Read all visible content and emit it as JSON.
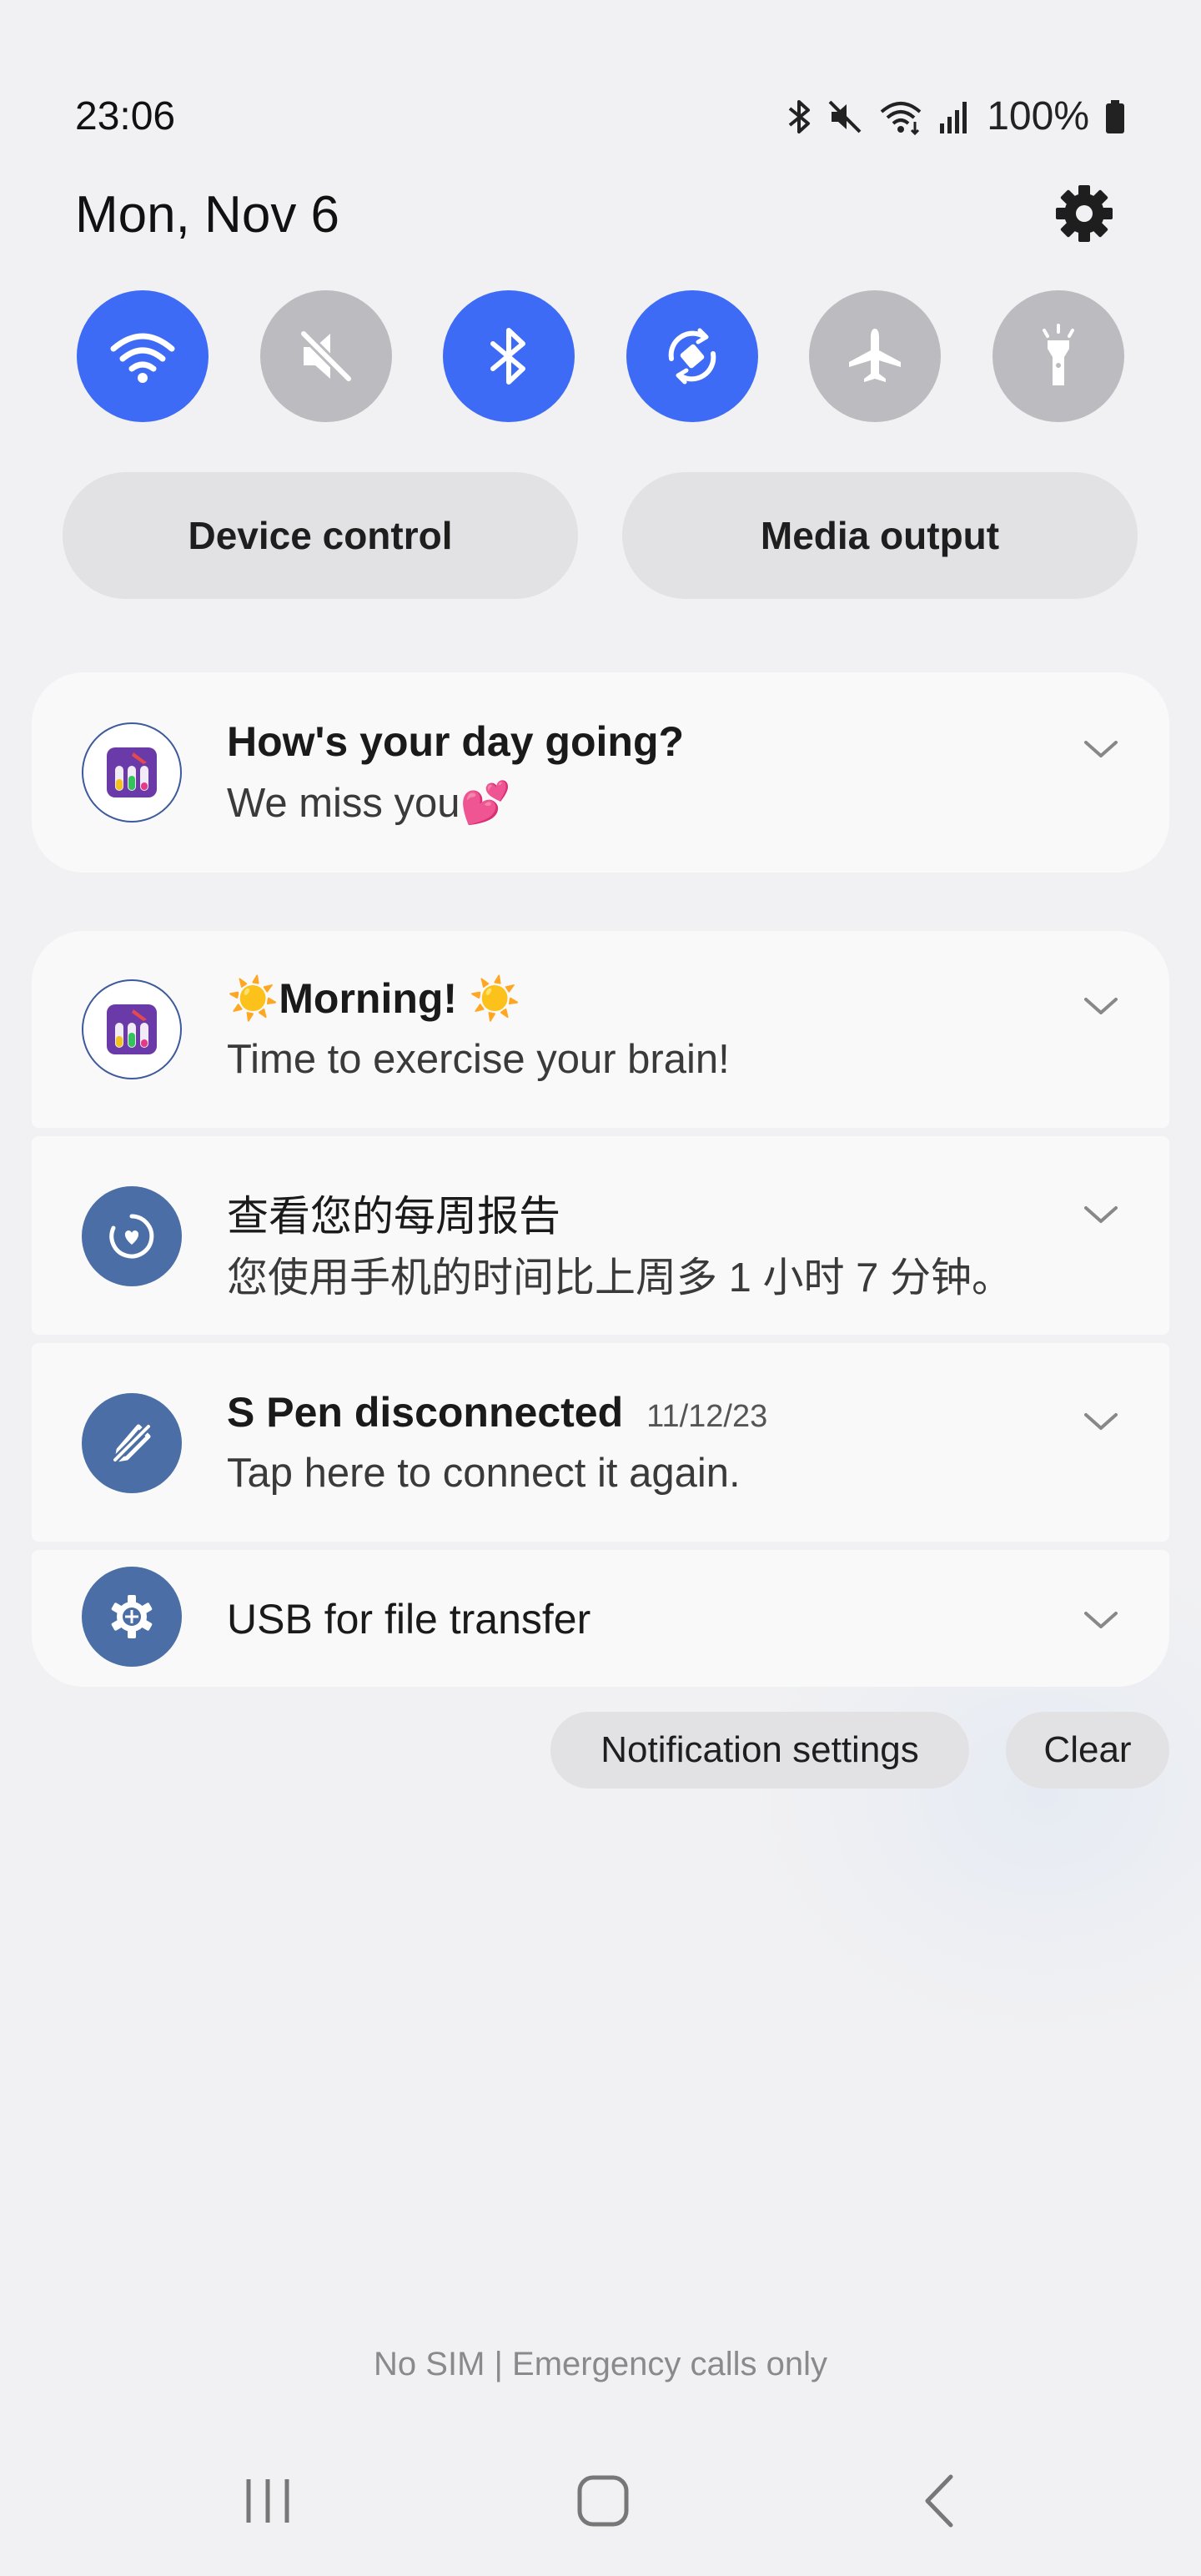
{
  "status": {
    "time": "23:06",
    "battery": "100%",
    "icons": [
      "bluetooth-icon",
      "mute-icon",
      "wifi-icon",
      "signal-icon",
      "battery-icon"
    ]
  },
  "header": {
    "date": "Mon, Nov 6"
  },
  "quick_toggles": [
    {
      "name": "wifi-icon",
      "on": true
    },
    {
      "name": "mute-icon",
      "on": false
    },
    {
      "name": "bluetooth-icon",
      "on": true
    },
    {
      "name": "auto-rotate-icon",
      "on": true
    },
    {
      "name": "airplane-icon",
      "on": false
    },
    {
      "name": "flashlight-icon",
      "on": false
    }
  ],
  "controls": {
    "device_control": "Device control",
    "media_output": "Media output"
  },
  "notifications": [
    {
      "title": "How's your day going?",
      "text": "We miss you💕",
      "icon": "game-app-icon"
    },
    {
      "title": "☀️Morning! ☀️",
      "text": "Time to exercise your brain!",
      "icon": "game-app-icon"
    },
    {
      "title": "查看您的每周报告",
      "text": "您使用手机的时间比上周多 1 小时 7 分钟。",
      "icon": "digital-wellbeing-icon"
    },
    {
      "title": "S Pen disconnected",
      "time": "11/12/23",
      "text": "Tap here to connect it again.",
      "icon": "s-pen-icon"
    },
    {
      "title": "USB for file transfer",
      "icon": "usb-settings-icon"
    }
  ],
  "actions": {
    "notification_settings": "Notification settings",
    "clear": "Clear"
  },
  "footer": {
    "carrier": "No SIM | Emergency calls only"
  },
  "colors": {
    "toggle_on": "#3e6bf6",
    "toggle_off": "#bcbcc0",
    "system_icon_bg": "#4a6ea5"
  }
}
